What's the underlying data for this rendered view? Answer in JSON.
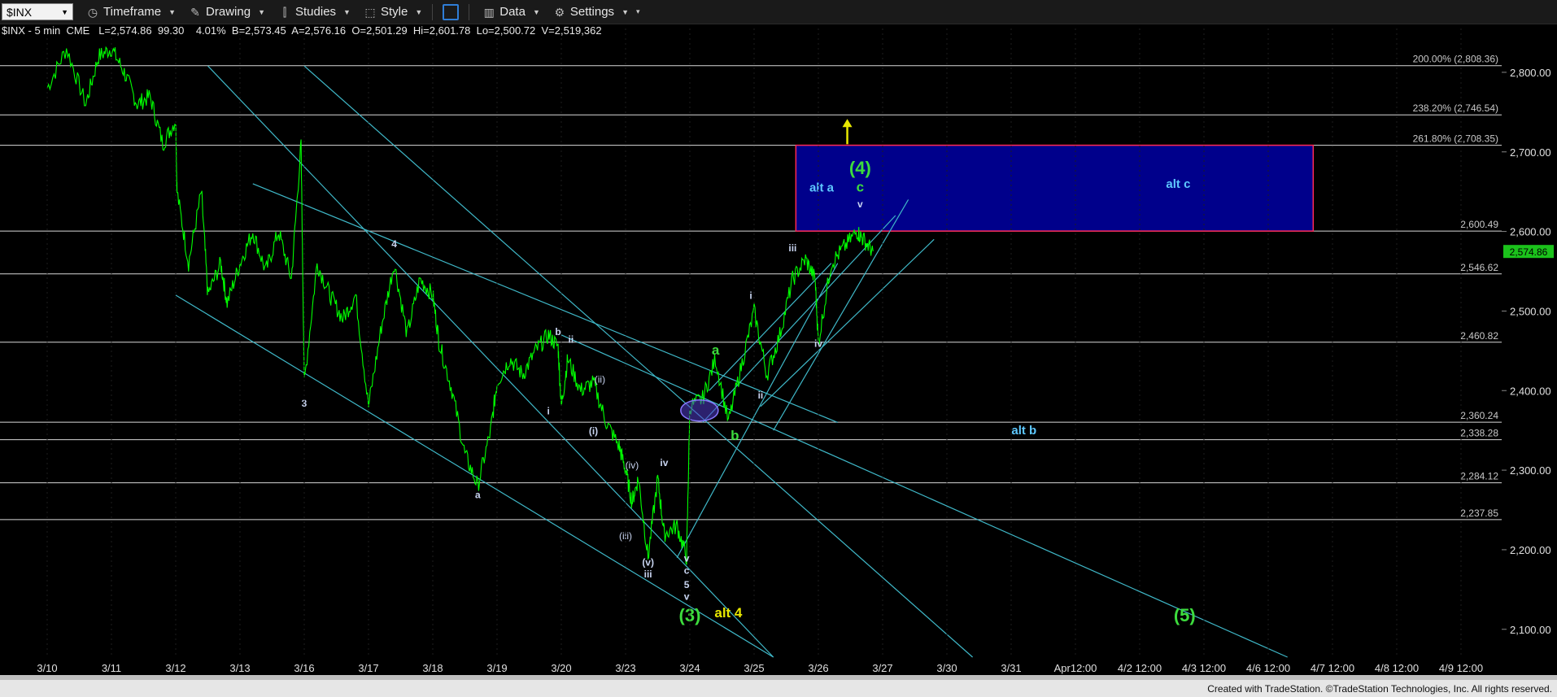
{
  "toolbar": {
    "symbol": "$INX",
    "timeframe": "Timeframe",
    "drawing": "Drawing",
    "studies": "Studies",
    "style": "Style",
    "data": "Data",
    "settings": "Settings"
  },
  "info_bar": "$INX - 5 min  CME   L=2,574.86  99.30    4.01%  B=2,573.45  A=2,576.16  O=2,501.29  Hi=2,601.78  Lo=2,500.72  V=2,519,362",
  "footer": "Created with TradeStation. ©TradeStation Technologies, Inc. All rights reserved.",
  "colors": {
    "price": "#00ff00",
    "lines": "#3fb8c8",
    "box": "#00008b",
    "box_border": "#ff2a55",
    "label_blue": "#5ec8ff",
    "label_green": "#3ddc3d",
    "label_yellow": "#e8e800",
    "label_white": "#c8d4f0"
  },
  "chart_data": {
    "type": "line",
    "symbol": "$INX",
    "interval": "5 min",
    "x_ticks": [
      "3/10",
      "3/11",
      "3/12",
      "3/13",
      "3/16",
      "3/17",
      "3/18",
      "3/19",
      "3/20",
      "3/23",
      "3/24",
      "3/25",
      "3/26",
      "3/27",
      "3/30",
      "3/31",
      "Apr12:00",
      "4/2 12:00",
      "4/3 12:00",
      "4/6 12:00",
      "4/7 12:00",
      "4/8 12:00",
      "4/9 12:00"
    ],
    "y_ticks": [
      "2,800.00",
      "2,700.00",
      "2,600.00",
      "2,500.00",
      "2,400.00",
      "2,300.00",
      "2,200.00",
      "2,100.00"
    ],
    "ylim": [
      2065,
      2850
    ],
    "last_price": {
      "value": 2574.86,
      "label": "2,574.86"
    },
    "series": [
      {
        "points": [
          [
            0,
            2780
          ],
          [
            0.3,
            2830
          ],
          [
            0.6,
            2760
          ],
          [
            0.8,
            2820
          ],
          [
            1,
            2830
          ],
          [
            1.2,
            2800
          ],
          [
            1.4,
            2760
          ],
          [
            1.6,
            2770
          ],
          [
            1.8,
            2710
          ],
          [
            2,
            2740
          ],
          [
            2.02,
            2650
          ],
          [
            2.2,
            2560
          ],
          [
            2.4,
            2650
          ],
          [
            2.5,
            2520
          ],
          [
            2.7,
            2560
          ],
          [
            2.8,
            2510
          ],
          [
            3,
            2560
          ],
          [
            3.2,
            2600
          ],
          [
            3.4,
            2550
          ],
          [
            3.6,
            2600
          ],
          [
            3.8,
            2540
          ],
          [
            3.95,
            2710
          ],
          [
            4,
            2410
          ],
          [
            4.2,
            2560
          ],
          [
            4.4,
            2520
          ],
          [
            4.6,
            2490
          ],
          [
            4.8,
            2520
          ],
          [
            5,
            2380
          ],
          [
            5.2,
            2480
          ],
          [
            5.4,
            2560
          ],
          [
            5.6,
            2470
          ],
          [
            5.8,
            2540
          ],
          [
            6,
            2520
          ],
          [
            6.1,
            2460
          ],
          [
            6.3,
            2400
          ],
          [
            6.5,
            2320
          ],
          [
            6.7,
            2280
          ],
          [
            6.9,
            2350
          ],
          [
            7,
            2410
          ],
          [
            7.2,
            2440
          ],
          [
            7.4,
            2420
          ],
          [
            7.6,
            2450
          ],
          [
            7.8,
            2470
          ],
          [
            7.95,
            2455
          ],
          [
            8,
            2380
          ],
          [
            8.1,
            2440
          ],
          [
            8.3,
            2400
          ],
          [
            8.5,
            2410
          ],
          [
            8.7,
            2360
          ],
          [
            8.9,
            2330
          ],
          [
            9,
            2300
          ],
          [
            9.1,
            2260
          ],
          [
            9.2,
            2290
          ],
          [
            9.35,
            2190
          ],
          [
            9.5,
            2290
          ],
          [
            9.6,
            2220
          ],
          [
            9.8,
            2230
          ],
          [
            9.95,
            2190
          ],
          [
            10,
            2380
          ],
          [
            10.2,
            2390
          ],
          [
            10.4,
            2440
          ],
          [
            10.6,
            2360
          ],
          [
            10.8,
            2430
          ],
          [
            11,
            2500
          ],
          [
            11.2,
            2420
          ],
          [
            11.4,
            2470
          ],
          [
            11.6,
            2540
          ],
          [
            11.8,
            2565
          ],
          [
            11.95,
            2540
          ],
          [
            12,
            2460
          ],
          [
            12.2,
            2560
          ],
          [
            12.4,
            2580
          ],
          [
            12.6,
            2600
          ],
          [
            12.7,
            2590
          ],
          [
            12.85,
            2575
          ]
        ]
      }
    ],
    "horizontal_levels": [
      {
        "value": 2808.36,
        "label": "200.00% (2,808.36)"
      },
      {
        "value": 2746.54,
        "label": "238.20% (2,746.54)"
      },
      {
        "value": 2708.35,
        "label": "261.80% (2,708.35)"
      },
      {
        "value": 2600.49,
        "label": "2,600.49"
      },
      {
        "value": 2546.62,
        "label": "2,546.62"
      },
      {
        "value": 2460.82,
        "label": "2,460.82"
      },
      {
        "value": 2360.24,
        "label": "2,360.24"
      },
      {
        "value": 2338.28,
        "label": "2,338.28"
      },
      {
        "value": 2284.12,
        "label": "2,284.12"
      },
      {
        "value": 2237.85,
        "label": "2,237.85"
      }
    ],
    "target_box": {
      "x_start": 11.65,
      "x_end": 19.7,
      "y_low": 2600.49,
      "y_high": 2708.35
    },
    "trendlines": [
      [
        [
          2.5,
          2808
        ],
        [
          11.3,
          2065
        ]
      ],
      [
        [
          2,
          2520
        ],
        [
          11.3,
          2065
        ]
      ],
      [
        [
          3.2,
          2660
        ],
        [
          12.3,
          2360
        ]
      ],
      [
        [
          4,
          2808
        ],
        [
          14.4,
          2065
        ]
      ],
      [
        [
          8,
          2470
        ],
        [
          19.3,
          2065
        ]
      ],
      [
        [
          9.8,
          2190
        ],
        [
          12.3,
          2560
        ]
      ],
      [
        [
          10.2,
          2360
        ],
        [
          13.2,
          2620
        ]
      ],
      [
        [
          11.3,
          2350
        ],
        [
          13.4,
          2640
        ]
      ],
      [
        [
          11.1,
          2380
        ],
        [
          13.8,
          2590
        ]
      ],
      [
        [
          10.3,
          2400
        ],
        [
          12.2,
          2560
        ]
      ]
    ],
    "annotations": [
      {
        "text": "3",
        "x": 4.0,
        "y": 2380,
        "color": "white"
      },
      {
        "text": "4",
        "x": 5.4,
        "y": 2580,
        "color": "white"
      },
      {
        "text": "a",
        "x": 6.7,
        "y": 2265,
        "color": "white"
      },
      {
        "text": "b",
        "x": 7.95,
        "y": 2470,
        "color": "white"
      },
      {
        "text": "ii",
        "x": 8.15,
        "y": 2460,
        "color": "white"
      },
      {
        "text": "i",
        "x": 7.8,
        "y": 2370,
        "color": "white"
      },
      {
        "text": "(ii)",
        "x": 8.6,
        "y": 2410,
        "color": "white"
      },
      {
        "text": "(i)",
        "x": 8.5,
        "y": 2345,
        "color": "white"
      },
      {
        "text": "(iv)",
        "x": 9.1,
        "y": 2302,
        "color": "white"
      },
      {
        "text": "iv",
        "x": 9.6,
        "y": 2305,
        "color": "white"
      },
      {
        "text": "(iii)",
        "x": 9.0,
        "y": 2213,
        "color": "white"
      },
      {
        "text": "(v)",
        "x": 9.35,
        "y": 2180,
        "color": "white"
      },
      {
        "text": "iii",
        "x": 9.35,
        "y": 2165,
        "color": "white"
      },
      {
        "text": "v",
        "x": 9.95,
        "y": 2185,
        "color": "white"
      },
      {
        "text": "c",
        "x": 9.95,
        "y": 2170,
        "color": "white"
      },
      {
        "text": "5",
        "x": 9.95,
        "y": 2152,
        "color": "white"
      },
      {
        "text": "v",
        "x": 9.95,
        "y": 2137,
        "color": "white"
      },
      {
        "text": "(3)",
        "x": 10.0,
        "y": 2110,
        "color": "green"
      },
      {
        "text": "alt 4",
        "x": 10.6,
        "y": 2115,
        "color": "yellow"
      },
      {
        "text": "a",
        "x": 10.4,
        "y": 2445,
        "color": "green"
      },
      {
        "text": "b",
        "x": 10.7,
        "y": 2338,
        "color": "green"
      },
      {
        "text": "i",
        "x": 10.95,
        "y": 2515,
        "color": "white"
      },
      {
        "text": "ii",
        "x": 11.1,
        "y": 2390,
        "color": "white"
      },
      {
        "text": "iii",
        "x": 11.6,
        "y": 2575,
        "color": "white"
      },
      {
        "text": "iv",
        "x": 12.0,
        "y": 2455,
        "color": "white"
      },
      {
        "text": "alt a",
        "x": 12.05,
        "y": 2650,
        "color": "blue"
      },
      {
        "text": "(4)",
        "x": 12.65,
        "y": 2672,
        "color": "green"
      },
      {
        "text": "c",
        "x": 12.65,
        "y": 2650,
        "color": "green"
      },
      {
        "text": "v",
        "x": 12.65,
        "y": 2630,
        "color": "white"
      },
      {
        "text": "alt c",
        "x": 17.6,
        "y": 2655,
        "color": "blue"
      },
      {
        "text": "alt b",
        "x": 15.2,
        "y": 2345,
        "color": "blue"
      },
      {
        "text": "(5)",
        "x": 17.7,
        "y": 2110,
        "color": "green"
      }
    ]
  }
}
